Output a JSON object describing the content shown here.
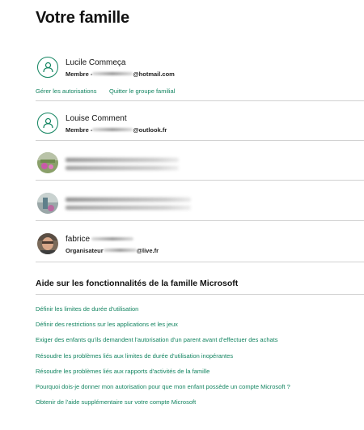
{
  "page_title": "Votre famille",
  "members": [
    {
      "name": "Lucile Commeça",
      "role": "Membre -",
      "email_domain": "@hotmail.com"
    },
    {
      "name": "Louise Comment",
      "role": "Membre -",
      "email_domain": "@outlook.fr"
    },
    {
      "name": "",
      "role": "",
      "email_domain": ""
    },
    {
      "name": "",
      "role": "",
      "email_domain": ""
    },
    {
      "name": "fabrice",
      "role": "Organisateur",
      "email_domain": "@live.fr"
    }
  ],
  "member_actions": {
    "manage_permissions": "Gérer les autorisations",
    "leave_group": "Quitter le groupe familial"
  },
  "help": {
    "title": "Aide sur les fonctionnalités de la famille Microsoft",
    "links": [
      "Définir les limites de durée d'utilisation",
      "Définir des restrictions sur les applications et les jeux",
      "Exiger des enfants qu'ils demandent l'autorisation d'un parent avant d'effectuer des achats",
      "Résoudre les problèmes liés aux limites de durée d'utilisation inopérantes",
      "Résoudre les problèmes liés aux rapports d'activités de la famille",
      "Pourquoi dois-je donner mon autorisation pour que mon enfant possède un compte Microsoft ?",
      "Obtenir de l'aide supplémentaire sur votre compte Microsoft"
    ]
  },
  "colors": {
    "accent": "#128460",
    "divider": "#d2d2d2",
    "text": "#111111"
  }
}
